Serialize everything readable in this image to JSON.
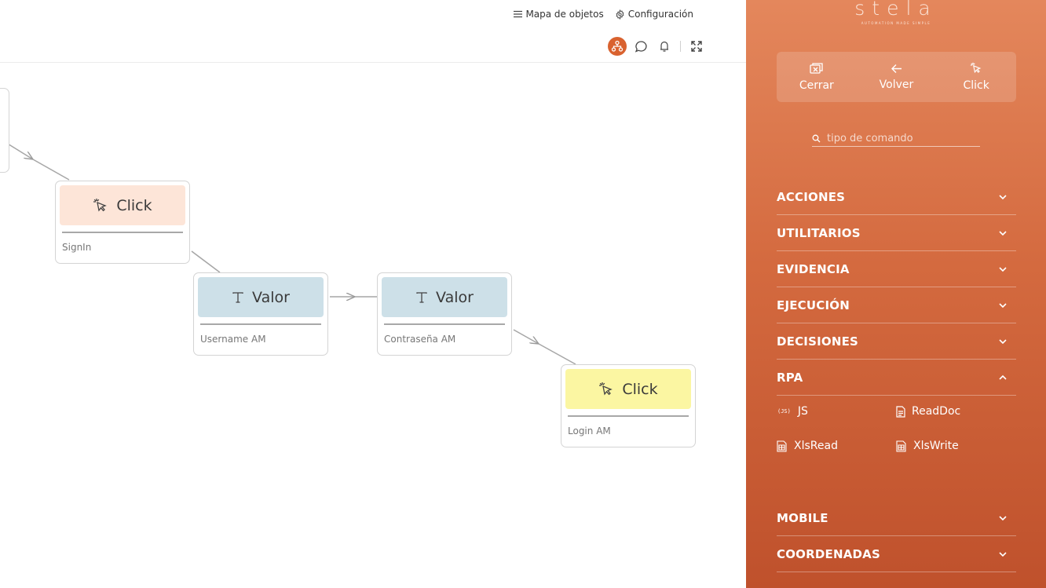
{
  "canvas": {
    "links": {
      "object_map": "Mapa de objetos",
      "settings": "Configuración"
    },
    "nodes": [
      {
        "title": "Click",
        "caption": "SignIn",
        "color": "#fde5d8"
      },
      {
        "title": "Valor",
        "caption": "Username AM",
        "color": "#cde0e8"
      },
      {
        "title": "Valor",
        "caption": "Contraseña AM",
        "color": "#cde0e8"
      },
      {
        "title": "Click",
        "caption": "Login AM",
        "color": "#fbf6a2"
      }
    ],
    "active_tool_color": "#d9622f"
  },
  "panel": {
    "brand": "stela",
    "tagline": "AUTOMATION MADE SIMPLE",
    "quick_actions": [
      "Cerrar",
      "Volver",
      "Click"
    ],
    "search_placeholder": "tipo de comando",
    "categories": [
      {
        "label": "ACCIONES",
        "expanded": false
      },
      {
        "label": "UTILITARIOS",
        "expanded": false
      },
      {
        "label": "EVIDENCIA",
        "expanded": false
      },
      {
        "label": "EJECUCIÓN",
        "expanded": false
      },
      {
        "label": "DECISIONES",
        "expanded": false
      },
      {
        "label": "RPA",
        "expanded": true
      },
      {
        "label": "MOBILE",
        "expanded": false
      },
      {
        "label": "COORDENADAS",
        "expanded": false
      }
    ],
    "rpa_items": [
      "JS",
      "ReadDoc",
      "XlsRead",
      "XlsWrite"
    ],
    "js_badge": "JS",
    "colors": {
      "gradient_top": "#e4875c",
      "gradient_bottom": "#bf512c"
    }
  }
}
